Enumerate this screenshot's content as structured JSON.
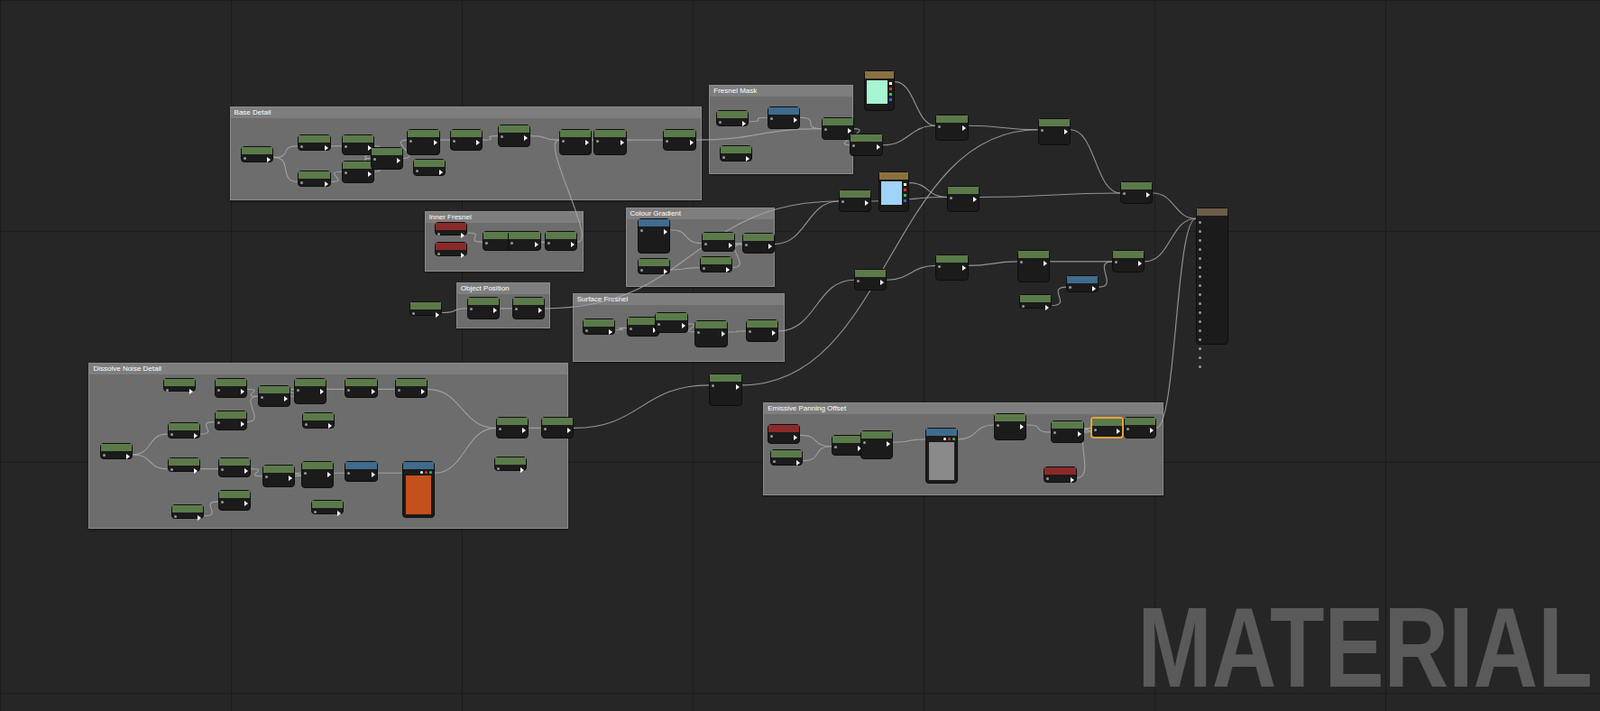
{
  "graph": {
    "comments": [
      {
        "title": "Base Detail"
      },
      {
        "title": "Fresnel Mask"
      },
      {
        "title": "Inner Fresnel"
      },
      {
        "title": "Colour Gradient"
      },
      {
        "title": "Object Position"
      },
      {
        "title": "Surface Fresnel"
      },
      {
        "title": "Dissolve Noise Detail"
      },
      {
        "title": "Emissive Panning Offset"
      }
    ],
    "nodes": [
      {
        "kind": "node",
        "color": "#5b7a4a",
        "selected": false
      },
      {
        "kind": "node",
        "color": "#5b7a4a",
        "selected": false
      },
      {
        "kind": "node",
        "color": "#5b7a4a",
        "selected": false
      },
      {
        "kind": "node",
        "color": "#5b7a4a",
        "selected": false
      },
      {
        "kind": "node",
        "color": "#5b7a4a",
        "selected": false
      },
      {
        "kind": "node",
        "color": "#5b7a4a",
        "selected": false
      },
      {
        "kind": "node",
        "color": "#5b7a4a",
        "selected": false
      },
      {
        "kind": "node",
        "color": "#5b7a4a",
        "selected": false
      },
      {
        "kind": "node",
        "color": "#5b7a4a",
        "selected": false
      },
      {
        "kind": "node",
        "color": "#5b7a4a",
        "selected": false
      },
      {
        "kind": "node",
        "color": "#5b7a4a",
        "selected": false
      },
      {
        "kind": "node",
        "color": "#5b7a4a",
        "selected": false
      },
      {
        "kind": "node",
        "color": "#5b7a4a",
        "selected": false
      },
      {
        "kind": "node",
        "color": "#5b7a4a",
        "selected": false
      },
      {
        "kind": "node",
        "color": "#5b7a4a",
        "selected": false
      },
      {
        "kind": "node",
        "color": "#3f6b8c",
        "selected": false
      },
      {
        "kind": "node",
        "color": "#5b7a4a",
        "selected": false
      },
      {
        "kind": "swatch",
        "color": "#8a7240",
        "fill": "#a8f5d2",
        "selected": false
      },
      {
        "kind": "node",
        "color": "#5b7a4a",
        "selected": false
      },
      {
        "kind": "node",
        "color": "#5b7a4a",
        "selected": false
      },
      {
        "kind": "node",
        "color": "#5b7a4a",
        "selected": false
      },
      {
        "kind": "swatch",
        "color": "#8a7240",
        "fill": "#9fd3f7",
        "selected": false
      },
      {
        "kind": "node",
        "color": "#5b7a4a",
        "selected": false
      },
      {
        "kind": "node",
        "color": "#5b7a4a",
        "selected": false
      },
      {
        "kind": "node",
        "color": "#5b7a4a",
        "selected": false
      },
      {
        "kind": "result",
        "color": "#6e5c4a",
        "selected": false
      },
      {
        "kind": "node",
        "color": "#8a2a2a",
        "selected": false
      },
      {
        "kind": "node",
        "color": "#8a2a2a",
        "selected": false
      },
      {
        "kind": "node",
        "color": "#5b7a4a",
        "selected": false
      },
      {
        "kind": "node",
        "color": "#5b7a4a",
        "selected": false
      },
      {
        "kind": "node",
        "color": "#5b7a4a",
        "selected": false
      },
      {
        "kind": "node",
        "color": "#3f6b8c",
        "selected": false
      },
      {
        "kind": "node",
        "color": "#5b7a4a",
        "selected": false
      },
      {
        "kind": "node",
        "color": "#5b7a4a",
        "selected": false
      },
      {
        "kind": "node",
        "color": "#5b7a4a",
        "selected": false
      },
      {
        "kind": "node",
        "color": "#5b7a4a",
        "selected": false
      },
      {
        "kind": "node",
        "color": "#5b7a4a",
        "selected": false
      },
      {
        "kind": "node",
        "color": "#5b7a4a",
        "selected": false
      },
      {
        "kind": "node",
        "color": "#5b7a4a",
        "selected": false
      },
      {
        "kind": "node",
        "color": "#5b7a4a",
        "selected": false
      },
      {
        "kind": "node",
        "color": "#5b7a4a",
        "selected": false
      },
      {
        "kind": "node",
        "color": "#3f6b8c",
        "selected": false
      },
      {
        "kind": "node",
        "color": "#5b7a4a",
        "selected": false
      },
      {
        "kind": "node",
        "color": "#5b7a4a",
        "selected": false
      },
      {
        "kind": "node",
        "color": "#5b7a4a",
        "selected": false
      },
      {
        "kind": "node",
        "color": "#5b7a4a",
        "selected": false
      },
      {
        "kind": "node",
        "color": "#5b7a4a",
        "selected": false
      },
      {
        "kind": "node",
        "color": "#5b7a4a",
        "selected": false
      },
      {
        "kind": "node",
        "color": "#5b7a4a",
        "selected": false
      },
      {
        "kind": "node",
        "color": "#5b7a4a",
        "selected": false
      },
      {
        "kind": "node",
        "color": "#5b7a4a",
        "selected": false
      },
      {
        "kind": "node",
        "color": "#5b7a4a",
        "selected": false
      },
      {
        "kind": "node",
        "color": "#5b7a4a",
        "selected": false
      },
      {
        "kind": "node",
        "color": "#5b7a4a",
        "selected": false
      },
      {
        "kind": "node",
        "color": "#5b7a4a",
        "selected": false
      },
      {
        "kind": "node",
        "color": "#5b7a4a",
        "selected": false
      },
      {
        "kind": "node",
        "color": "#5b7a4a",
        "selected": false
      },
      {
        "kind": "node",
        "color": "#5b7a4a",
        "selected": false
      },
      {
        "kind": "node",
        "color": "#5b7a4a",
        "selected": false
      },
      {
        "kind": "node",
        "color": "#5b7a4a",
        "selected": false
      },
      {
        "kind": "node",
        "color": "#5b7a4a",
        "selected": false
      },
      {
        "kind": "node",
        "color": "#5b7a4a",
        "selected": false
      },
      {
        "kind": "node",
        "color": "#5b7a4a",
        "selected": false
      },
      {
        "kind": "node",
        "color": "#5b7a4a",
        "selected": false
      },
      {
        "kind": "node",
        "color": "#5b7a4a",
        "selected": false
      },
      {
        "kind": "node",
        "color": "#3f6b8c",
        "selected": false
      },
      {
        "kind": "texture",
        "color": "#3f6b8c",
        "fill": "#c4501c",
        "selected": false
      },
      {
        "kind": "node",
        "color": "#5b7a4a",
        "selected": false
      },
      {
        "kind": "node",
        "color": "#5b7a4a",
        "selected": false
      },
      {
        "kind": "node",
        "color": "#5b7a4a",
        "selected": false
      },
      {
        "kind": "node",
        "color": "#5b7a4a",
        "selected": false
      },
      {
        "kind": "node",
        "color": "#5b7a4a",
        "selected": false
      },
      {
        "kind": "node",
        "color": "#5b7a4a",
        "selected": false
      },
      {
        "kind": "node",
        "color": "#8a2a2a",
        "selected": false
      },
      {
        "kind": "node",
        "color": "#5b7a4a",
        "selected": false
      },
      {
        "kind": "node",
        "color": "#5b7a4a",
        "selected": false
      },
      {
        "kind": "node",
        "color": "#5b7a4a",
        "selected": false
      },
      {
        "kind": "texture",
        "color": "#3f6b8c",
        "fill": "#8a8a8a",
        "selected": false
      },
      {
        "kind": "node",
        "color": "#5b7a4a",
        "selected": false
      },
      {
        "kind": "node",
        "color": "#5b7a4a",
        "selected": false
      },
      {
        "kind": "node",
        "color": "#5b7a4a",
        "selected": true
      },
      {
        "kind": "node",
        "color": "#5b7a4a",
        "selected": false
      },
      {
        "kind": "node",
        "color": "#8a2a2a",
        "selected": false
      }
    ],
    "watermark": "MATERIAL"
  }
}
